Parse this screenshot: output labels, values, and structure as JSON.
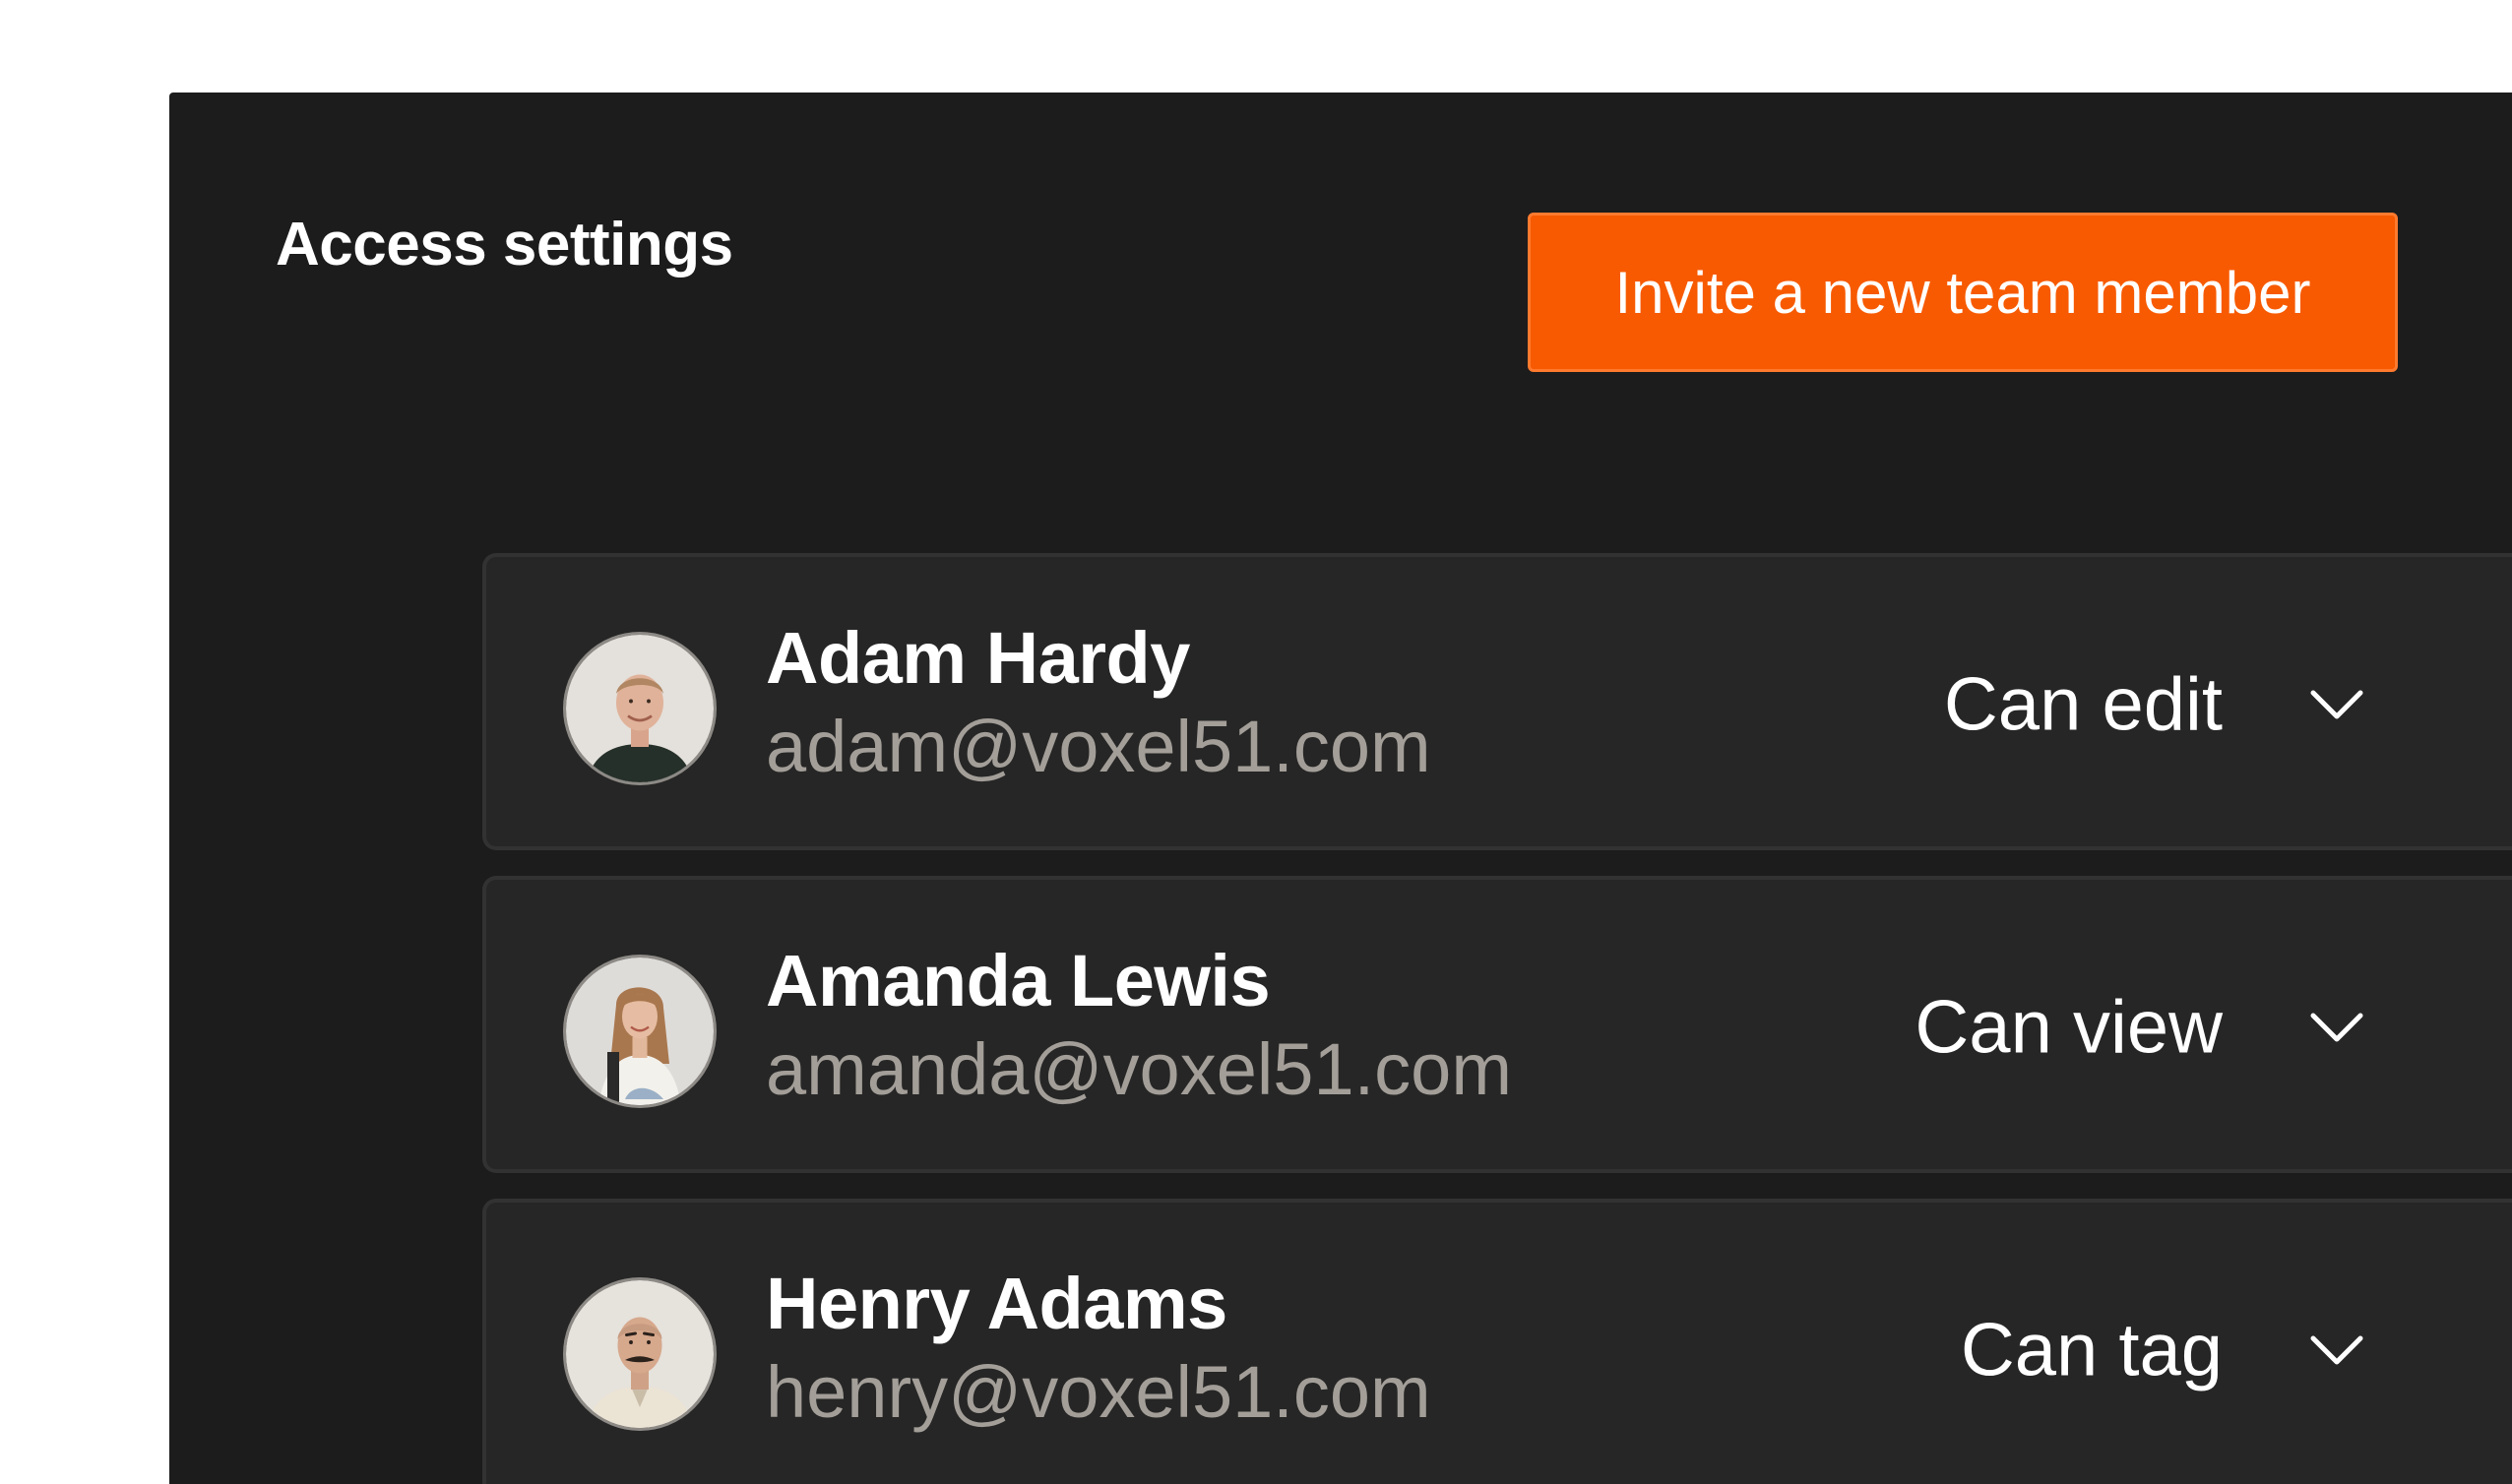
{
  "panel": {
    "title": "Access settings",
    "invite_button": "Invite a new team member"
  },
  "members": [
    {
      "name": "Adam Hardy",
      "email": "adam@voxel51.com",
      "role": "Can edit"
    },
    {
      "name": "Amanda Lewis",
      "email": "amanda@voxel51.com",
      "role": "Can view"
    },
    {
      "name": "Henry Adams",
      "email": "henry@voxel51.com",
      "role": "Can tag"
    }
  ],
  "icons": {
    "dropdown": "chevron-down-icon",
    "avatar": "avatar-photo"
  },
  "colors": {
    "accent": "#f75a00",
    "panel_background": "#1c1c1c",
    "card_background": "#262626",
    "email_text": "#a39e98"
  }
}
